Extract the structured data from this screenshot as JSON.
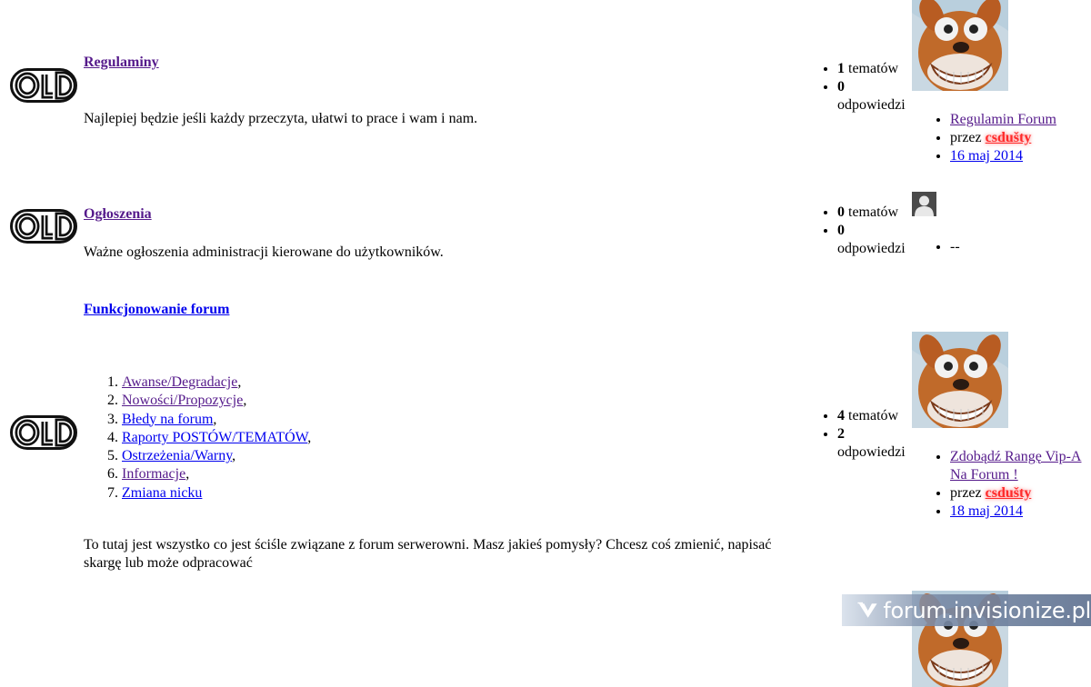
{
  "forums": [
    {
      "title": "Regulaminy",
      "description": "Najlepiej będzie jeśli każdy przeczyta, ułatwi to prace i wam i nam.",
      "topics_count": "1",
      "topics_label": " tematów",
      "replies_count": "0",
      "replies_label": "odpowiedzi",
      "last_post": {
        "title": "Regulamin Forum",
        "by_label": "przez ",
        "author": "csdušty",
        "date": "16 maj 2014"
      }
    },
    {
      "title": "Ogłoszenia",
      "description": "Ważne ogłoszenia administracji kierowane do użytkowników.",
      "topics_count": "0",
      "topics_label": " tematów",
      "replies_count": "0",
      "replies_label": "odpowiedzi",
      "last_post": {
        "empty": "--"
      }
    },
    {
      "title": "Funkcjonowanie forum",
      "subforums": [
        {
          "label": "Awanse/Degradacje",
          "sep": ","
        },
        {
          "label": "Nowości/Propozycje",
          "sep": ","
        },
        {
          "label": "Błedy na forum",
          "sep": ","
        },
        {
          "label": "Raporty POSTÓW/TEMATÓW",
          "sep": ","
        },
        {
          "label": "Ostrzeżenia/Warny",
          "sep": ","
        },
        {
          "label": "Informacje",
          "sep": ","
        },
        {
          "label": "Zmiana nicku",
          "sep": ""
        }
      ],
      "description": "To tutaj jest wszystko co jest ściśle związane z forum serwerowni. Masz jakieś pomysły? Chcesz coś zmienić, napisać skargę lub może odpracować",
      "topics_count": "4",
      "topics_label": " tematów",
      "replies_count": "2",
      "replies_label": "odpowiedzi",
      "last_post": {
        "title": "Zdobądź Rangę Vip-A Na Forum !",
        "by_label": "przez ",
        "author": "csdušty",
        "date": "18 maj 2014"
      }
    }
  ],
  "watermark": {
    "text": "forum.invisionize.pl"
  }
}
